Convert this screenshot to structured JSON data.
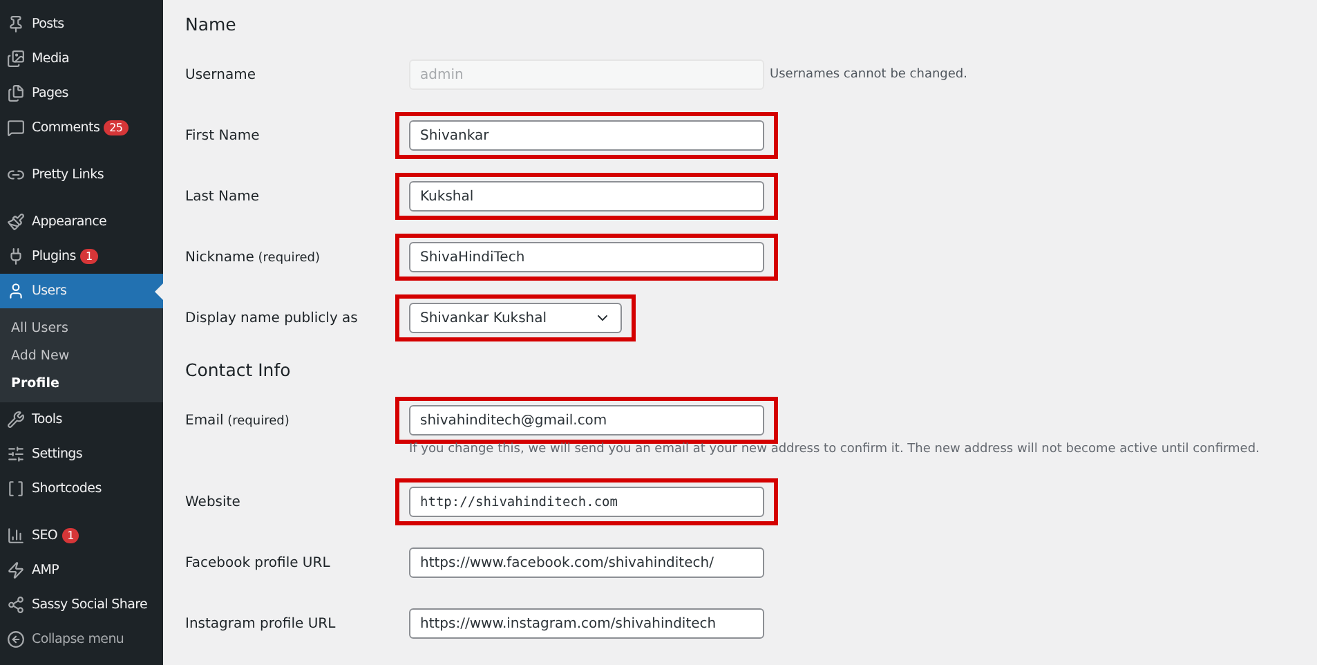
{
  "sidebar": {
    "groups": [
      [
        {
          "label": "Posts"
        },
        {
          "label": "Media"
        },
        {
          "label": "Pages"
        },
        {
          "label": "Comments",
          "badge": "25"
        }
      ],
      [
        {
          "label": "Pretty Links"
        }
      ],
      [
        {
          "label": "Appearance"
        },
        {
          "label": "Plugins",
          "badge": "1"
        },
        {
          "label": "Users",
          "selected": true,
          "children": [
            {
              "label": "All Users",
              "selected": false
            },
            {
              "label": "Add New",
              "selected": false
            },
            {
              "label": "Profile",
              "selected": true
            }
          ]
        },
        {
          "label": "Tools"
        },
        {
          "label": "Settings"
        },
        {
          "label": "Shortcodes"
        }
      ],
      [
        {
          "label": "SEO",
          "badge": "1"
        },
        {
          "label": "AMP"
        },
        {
          "label": "Sassy Social Share"
        },
        {
          "label": "Collapse menu",
          "kind": "collapse"
        }
      ]
    ]
  },
  "form": [
    {
      "kind": "heading",
      "label": "Name"
    },
    {
      "kind": "text",
      "label": "Username",
      "value": "admin",
      "disabled": true,
      "highlighted": false,
      "note": "Usernames cannot be changed."
    },
    {
      "kind": "text",
      "label": "First Name",
      "value": "Shivankar",
      "highlighted": true
    },
    {
      "kind": "text",
      "label": "Last Name",
      "value": "Kukshal",
      "highlighted": true
    },
    {
      "kind": "text",
      "label": "Nickname",
      "label_suffix": "(required)",
      "value": "ShivaHindiTech",
      "highlighted": true
    },
    {
      "kind": "select",
      "label": "Display name publicly as",
      "value": "Shivankar Kukshal",
      "highlighted": true
    },
    {
      "kind": "heading",
      "label": "Contact Info"
    },
    {
      "kind": "text",
      "label": "Email",
      "label_suffix": "(required)",
      "value": "shivahinditech@gmail.com",
      "highlighted": true,
      "description": "If you change this, we will send you an email at your new address to confirm it. The new address will not become active until confirmed."
    },
    {
      "kind": "text",
      "label": "Website",
      "value": "http://shivahinditech.com",
      "monospace": true,
      "highlighted": true
    },
    {
      "kind": "text",
      "label": "Facebook profile URL",
      "value": "https://www.facebook.com/shivahinditech/",
      "highlighted": false
    },
    {
      "kind": "text",
      "label": "Instagram profile URL",
      "value": "https://www.instagram.com/shivahinditech",
      "highlighted": false
    }
  ]
}
